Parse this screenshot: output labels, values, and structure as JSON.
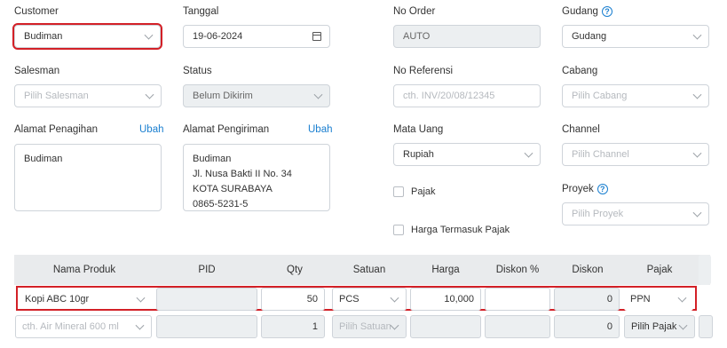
{
  "form": {
    "customer": {
      "label": "Customer",
      "value": "Budiman"
    },
    "tanggal": {
      "label": "Tanggal",
      "value": "19-06-2024"
    },
    "no_order": {
      "label": "No Order",
      "value": "AUTO"
    },
    "gudang": {
      "label": "Gudang",
      "value": "Gudang"
    },
    "salesman": {
      "label": "Salesman",
      "placeholder": "Pilih Salesman"
    },
    "status": {
      "label": "Status",
      "value": "Belum Dikirim"
    },
    "no_referensi": {
      "label": "No Referensi",
      "placeholder": "cth. INV/20/08/12345"
    },
    "cabang": {
      "label": "Cabang",
      "placeholder": "Pilih Cabang"
    },
    "alamat_penagihan": {
      "label": "Alamat Penagihan",
      "edit": "Ubah",
      "lines": [
        "Budiman"
      ]
    },
    "alamat_pengiriman": {
      "label": "Alamat Pengiriman",
      "edit": "Ubah",
      "lines": [
        "Budiman",
        "Jl. Nusa Bakti II No. 34",
        "KOTA SURABAYA",
        "0865-5231-5"
      ]
    },
    "mata_uang": {
      "label": "Mata Uang",
      "value": "Rupiah"
    },
    "channel": {
      "label": "Channel",
      "placeholder": "Pilih Channel"
    },
    "pajak_checkbox": "Pajak",
    "harga_termasuk_pajak": "Harga Termasuk Pajak",
    "proyek": {
      "label": "Proyek",
      "placeholder": "Pilih Proyek"
    }
  },
  "table": {
    "headers": [
      "Nama Produk",
      "PID",
      "Qty",
      "Satuan",
      "Harga",
      "Diskon %",
      "Diskon",
      "Pajak"
    ],
    "rows": [
      {
        "produk": "Kopi ABC 10gr",
        "pid": "",
        "qty": "50",
        "satuan": "PCS",
        "harga": "10,000",
        "diskon_pct": "",
        "diskon": "0",
        "pajak": "PPN"
      },
      {
        "produk": "cth. Air Mineral 600 ml",
        "pid": "",
        "qty": "1",
        "satuan": "Pilih Satuan",
        "harga": "",
        "diskon_pct": "",
        "diskon": "0",
        "pajak": "Pilih Pajak"
      }
    ]
  },
  "colors": {
    "accent": "#1a7fd0",
    "highlight": "#d32027"
  }
}
